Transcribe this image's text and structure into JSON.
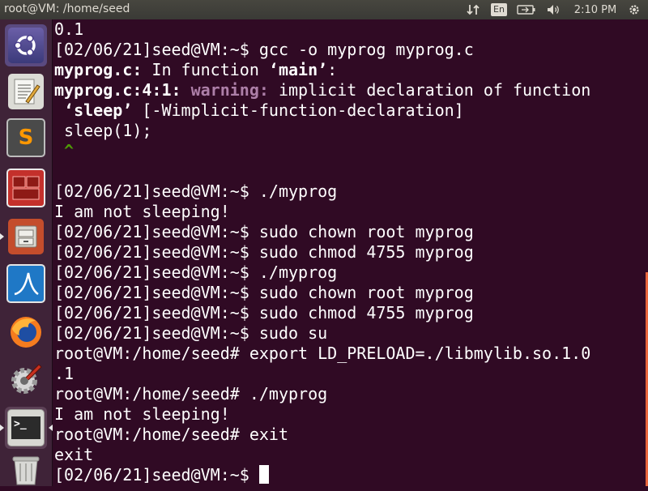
{
  "window": {
    "title": "root@VM: /home/seed"
  },
  "panel": {
    "language": "En",
    "clock": "2:10 PM",
    "icons": [
      "network-icon",
      "keyboard-language-icon",
      "battery-icon",
      "volume-icon",
      "settings-gear-icon"
    ]
  },
  "launcher": {
    "items": [
      {
        "name": "ubuntu-dash",
        "icon": "ubuntu-logo-icon"
      },
      {
        "name": "text-editor",
        "icon": "text-editor-icon"
      },
      {
        "name": "sublime-text",
        "icon": "sublime-text-icon",
        "label": "S"
      },
      {
        "name": "terminator",
        "icon": "terminator-icon"
      },
      {
        "name": "file-manager",
        "icon": "file-cabinet-icon"
      },
      {
        "name": "wireshark",
        "icon": "wireshark-fin-icon"
      },
      {
        "name": "firefox",
        "icon": "firefox-icon"
      },
      {
        "name": "system-settings",
        "icon": "system-settings-icon"
      },
      {
        "name": "terminal",
        "icon": "terminal-icon",
        "label": ">_"
      },
      {
        "name": "trash",
        "icon": "trash-icon"
      }
    ]
  },
  "terminal": {
    "prompt_user": "[02/06/21]seed@VM:~$",
    "lines": [
      "0.1",
      "[02/06/21]seed@VM:~$ gcc -o myprog myprog.c",
      {
        "bold": "myprog.c:",
        "text": " In function ",
        "quoted": "‘main’",
        "end": ":"
      },
      {
        "bold": "myprog.c:4:1:",
        "warn": " warning:",
        "text": " implicit declaration of function"
      },
      {
        "quoted": " ‘sleep’",
        "text": " [-Wimplicit-function-declaration]"
      },
      " sleep(1);",
      " ^",
      "",
      "[02/06/21]seed@VM:~$ ./myprog",
      "I am not sleeping!",
      "[02/06/21]seed@VM:~$ sudo chown root myprog",
      "[02/06/21]seed@VM:~$ sudo chmod 4755 myprog",
      "[02/06/21]seed@VM:~$ ./myprog",
      "[02/06/21]seed@VM:~$ sudo chown root myprog",
      "[02/06/21]seed@VM:~$ sudo chmod 4755 myprog",
      "[02/06/21]seed@VM:~$ sudo su",
      "root@VM:/home/seed# export LD_PRELOAD=./libmylib.so.1.0",
      ".1",
      "root@VM:/home/seed# ./myprog",
      "I am not sleeping!",
      "root@VM:/home/seed# exit",
      "exit",
      "[02/06/21]seed@VM:~$ "
    ]
  },
  "colors": {
    "terminal_bg": "#300a24",
    "launcher_bg": "#3f2338",
    "panel_bg": "#3c3b37",
    "warning": "#ad7fa8",
    "caret": "#4e9a06",
    "scrollbar": "#e8663d"
  }
}
